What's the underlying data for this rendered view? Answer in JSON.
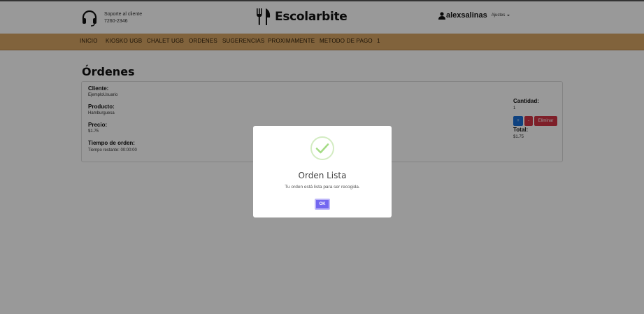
{
  "header": {
    "support_line1": "Soporte al cliente",
    "support_line2": "7260-2346",
    "brand": "Escolarbite",
    "username": "alexsalinas",
    "settings_label": "Ajustes"
  },
  "nav": {
    "items": [
      "INICIO",
      "KIOSKO UGB",
      "CHALET UGB",
      "ORDENES",
      "SUGERENCIAS",
      "PROXIMAMENTE",
      "METODO DE PAGO",
      "1"
    ]
  },
  "page": {
    "title": "Órdenes"
  },
  "order": {
    "client_label": "Cliente:",
    "client_value": "EjemploUsuario",
    "product_label": "Producto:",
    "product_value": "Hamburguesa",
    "price_label": "Precio:",
    "price_value": "$1.75",
    "time_label": "Tiempo de orden:",
    "time_value": "Tiempo restante: 00:00:00",
    "qty_label": "Cantidad:",
    "qty_value": "1",
    "plus_label": "+",
    "minus_label": "-",
    "delete_label": "Eliminar",
    "total_label": "Total:",
    "total_value": "$1.75"
  },
  "modal": {
    "title": "Orden Lista",
    "text": "Tu orden está lista para ser recogida.",
    "ok_label": "OK"
  },
  "colors": {
    "nav_bg": "#d7a665",
    "primary": "#1a6fd6",
    "danger": "#d33545",
    "modal_button": "#7367f0",
    "success_check": "#a5dc86"
  },
  "icons": {
    "support": "headset-icon",
    "brand": "fork-knife-icon",
    "user": "user-icon",
    "success": "check-icon"
  }
}
